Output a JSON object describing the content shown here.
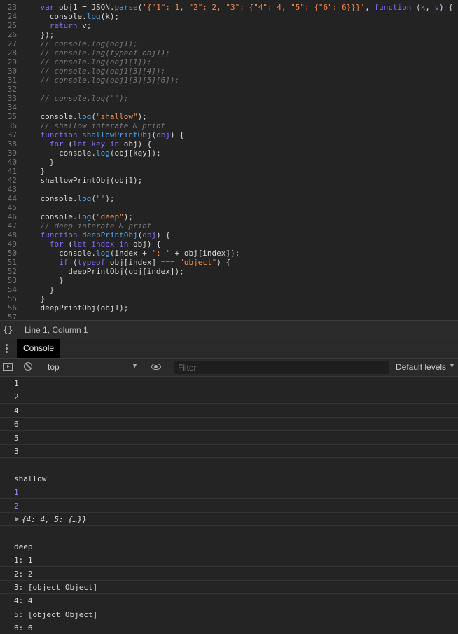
{
  "editor": {
    "lines": [
      {
        "n": "23",
        "tokens": [
          {
            "c": "pl",
            "t": "    "
          },
          {
            "c": "kw",
            "t": "var"
          },
          {
            "c": "pl",
            "t": " obj1 = JSON."
          },
          {
            "c": "fn",
            "t": "parse"
          },
          {
            "c": "pl",
            "t": "("
          },
          {
            "c": "str",
            "t": "'{\"1\": 1, \"2\": 2, \"3\": {\"4\": 4, \"5\": {\"6\": 6}}}'"
          },
          {
            "c": "pl",
            "t": ", "
          },
          {
            "c": "kw",
            "t": "function"
          },
          {
            "c": "pl",
            "t": " ("
          },
          {
            "c": "kw",
            "t": "k"
          },
          {
            "c": "pl",
            "t": ", "
          },
          {
            "c": "kw",
            "t": "v"
          },
          {
            "c": "pl",
            "t": ") {"
          }
        ]
      },
      {
        "n": "24",
        "tokens": [
          {
            "c": "pl",
            "t": "      console."
          },
          {
            "c": "fn",
            "t": "log"
          },
          {
            "c": "pl",
            "t": "(k);"
          }
        ]
      },
      {
        "n": "25",
        "tokens": [
          {
            "c": "pl",
            "t": "      "
          },
          {
            "c": "kw",
            "t": "return"
          },
          {
            "c": "pl",
            "t": " v;"
          }
        ]
      },
      {
        "n": "26",
        "tokens": [
          {
            "c": "pl",
            "t": "    });"
          }
        ]
      },
      {
        "n": "27",
        "tokens": [
          {
            "c": "cm",
            "t": "    // console.log(obj1);"
          }
        ]
      },
      {
        "n": "28",
        "tokens": [
          {
            "c": "cm",
            "t": "    // console.log(typeof obj1);"
          }
        ]
      },
      {
        "n": "29",
        "tokens": [
          {
            "c": "cm",
            "t": "    // console.log(obj1[1]);"
          }
        ]
      },
      {
        "n": "30",
        "tokens": [
          {
            "c": "cm",
            "t": "    // console.log(obj1[3][4]);"
          }
        ]
      },
      {
        "n": "31",
        "tokens": [
          {
            "c": "cm",
            "t": "    // console.log(obj1[3][5][6]);"
          }
        ]
      },
      {
        "n": "32",
        "tokens": []
      },
      {
        "n": "33",
        "tokens": [
          {
            "c": "cm",
            "t": "    // console.log(\"\");"
          }
        ]
      },
      {
        "n": "34",
        "tokens": []
      },
      {
        "n": "35",
        "tokens": [
          {
            "c": "pl",
            "t": "    console."
          },
          {
            "c": "fn",
            "t": "log"
          },
          {
            "c": "pl",
            "t": "("
          },
          {
            "c": "str",
            "t": "\"shallow\""
          },
          {
            "c": "pl",
            "t": ");"
          }
        ]
      },
      {
        "n": "36",
        "tokens": [
          {
            "c": "cm",
            "t": "    // shallow interate & print"
          }
        ]
      },
      {
        "n": "37",
        "tokens": [
          {
            "c": "pl",
            "t": "    "
          },
          {
            "c": "kw",
            "t": "function"
          },
          {
            "c": "pl",
            "t": " "
          },
          {
            "c": "fn",
            "t": "shallowPrintObj"
          },
          {
            "c": "pl",
            "t": "("
          },
          {
            "c": "kw",
            "t": "obj"
          },
          {
            "c": "pl",
            "t": ") {"
          }
        ]
      },
      {
        "n": "38",
        "tokens": [
          {
            "c": "pl",
            "t": "      "
          },
          {
            "c": "kw",
            "t": "for"
          },
          {
            "c": "pl",
            "t": " ("
          },
          {
            "c": "kw",
            "t": "let key in"
          },
          {
            "c": "pl",
            "t": " obj) {"
          }
        ]
      },
      {
        "n": "39",
        "tokens": [
          {
            "c": "pl",
            "t": "        console."
          },
          {
            "c": "fn",
            "t": "log"
          },
          {
            "c": "pl",
            "t": "(obj[key]);"
          }
        ]
      },
      {
        "n": "40",
        "tokens": [
          {
            "c": "pl",
            "t": "      }"
          }
        ]
      },
      {
        "n": "41",
        "tokens": [
          {
            "c": "pl",
            "t": "    }"
          }
        ]
      },
      {
        "n": "42",
        "tokens": [
          {
            "c": "pl",
            "t": "    shallowPrintObj(obj1);"
          }
        ]
      },
      {
        "n": "43",
        "tokens": []
      },
      {
        "n": "44",
        "tokens": [
          {
            "c": "pl",
            "t": "    console."
          },
          {
            "c": "fn",
            "t": "log"
          },
          {
            "c": "pl",
            "t": "("
          },
          {
            "c": "str",
            "t": "\"\""
          },
          {
            "c": "pl",
            "t": ");"
          }
        ]
      },
      {
        "n": "45",
        "tokens": []
      },
      {
        "n": "46",
        "tokens": [
          {
            "c": "pl",
            "t": "    console."
          },
          {
            "c": "fn",
            "t": "log"
          },
          {
            "c": "pl",
            "t": "("
          },
          {
            "c": "str",
            "t": "\"deep\""
          },
          {
            "c": "pl",
            "t": ");"
          }
        ]
      },
      {
        "n": "47",
        "tokens": [
          {
            "c": "cm",
            "t": "    // deep interate & print"
          }
        ]
      },
      {
        "n": "48",
        "tokens": [
          {
            "c": "pl",
            "t": "    "
          },
          {
            "c": "kw",
            "t": "function"
          },
          {
            "c": "pl",
            "t": " "
          },
          {
            "c": "fn",
            "t": "deepPrintObj"
          },
          {
            "c": "pl",
            "t": "("
          },
          {
            "c": "kw",
            "t": "obj"
          },
          {
            "c": "pl",
            "t": ") {"
          }
        ]
      },
      {
        "n": "49",
        "tokens": [
          {
            "c": "pl",
            "t": "      "
          },
          {
            "c": "kw",
            "t": "for"
          },
          {
            "c": "pl",
            "t": " ("
          },
          {
            "c": "kw",
            "t": "let index in"
          },
          {
            "c": "pl",
            "t": " obj) {"
          }
        ]
      },
      {
        "n": "50",
        "tokens": [
          {
            "c": "pl",
            "t": "        console."
          },
          {
            "c": "fn",
            "t": "log"
          },
          {
            "c": "pl",
            "t": "(index + "
          },
          {
            "c": "str",
            "t": "': '"
          },
          {
            "c": "pl",
            "t": " + obj[index]);"
          }
        ]
      },
      {
        "n": "51",
        "tokens": [
          {
            "c": "pl",
            "t": "        "
          },
          {
            "c": "kw",
            "t": "if"
          },
          {
            "c": "pl",
            "t": " ("
          },
          {
            "c": "kw",
            "t": "typeof"
          },
          {
            "c": "pl",
            "t": " obj[index] "
          },
          {
            "c": "kw",
            "t": "==="
          },
          {
            "c": "pl",
            "t": " "
          },
          {
            "c": "str",
            "t": "\"object\""
          },
          {
            "c": "pl",
            "t": ") {"
          }
        ]
      },
      {
        "n": "52",
        "tokens": [
          {
            "c": "pl",
            "t": "          deepPrintObj(obj[index]);"
          }
        ]
      },
      {
        "n": "53",
        "tokens": [
          {
            "c": "pl",
            "t": "        }"
          }
        ]
      },
      {
        "n": "54",
        "tokens": [
          {
            "c": "pl",
            "t": "      }"
          }
        ]
      },
      {
        "n": "55",
        "tokens": [
          {
            "c": "pl",
            "t": "    }"
          }
        ]
      },
      {
        "n": "56",
        "tokens": [
          {
            "c": "pl",
            "t": "    deepPrintObj(obj1);"
          }
        ]
      },
      {
        "n": "57",
        "tokens": []
      }
    ]
  },
  "statusbar": {
    "braces_icon": "{}",
    "cursor_position": "Line 1, Column 1"
  },
  "drawer": {
    "tab_console": "Console"
  },
  "toolbar": {
    "context": "top",
    "filter_placeholder": "Filter",
    "levels": "Default levels"
  },
  "console": {
    "messages": [
      {
        "text": "1",
        "kind": "plain"
      },
      {
        "text": "2",
        "kind": "plain"
      },
      {
        "text": "4",
        "kind": "plain"
      },
      {
        "text": "6",
        "kind": "plain"
      },
      {
        "text": "5",
        "kind": "plain"
      },
      {
        "text": "3",
        "kind": "plain"
      },
      {
        "text": "",
        "kind": "plain"
      },
      {
        "text": "shallow",
        "kind": "plain"
      },
      {
        "text": "1",
        "kind": "num"
      },
      {
        "text": "2",
        "kind": "num"
      },
      {
        "text": "{4: 4, 5: {…}}",
        "kind": "obj"
      },
      {
        "text": "",
        "kind": "plain"
      },
      {
        "text": "deep",
        "kind": "plain"
      },
      {
        "text": "1: 1",
        "kind": "plain"
      },
      {
        "text": "2: 2",
        "kind": "plain"
      },
      {
        "text": "3: [object Object]",
        "kind": "plain"
      },
      {
        "text": "4: 4",
        "kind": "plain"
      },
      {
        "text": "5: [object Object]",
        "kind": "plain"
      },
      {
        "text": "6: 6",
        "kind": "plain"
      }
    ]
  },
  "colors": {
    "keyword": "#8a6cf5",
    "function": "#4fa6ea",
    "string": "#f28b54",
    "comment": "#777777",
    "number_output": "#9b8cf7"
  }
}
